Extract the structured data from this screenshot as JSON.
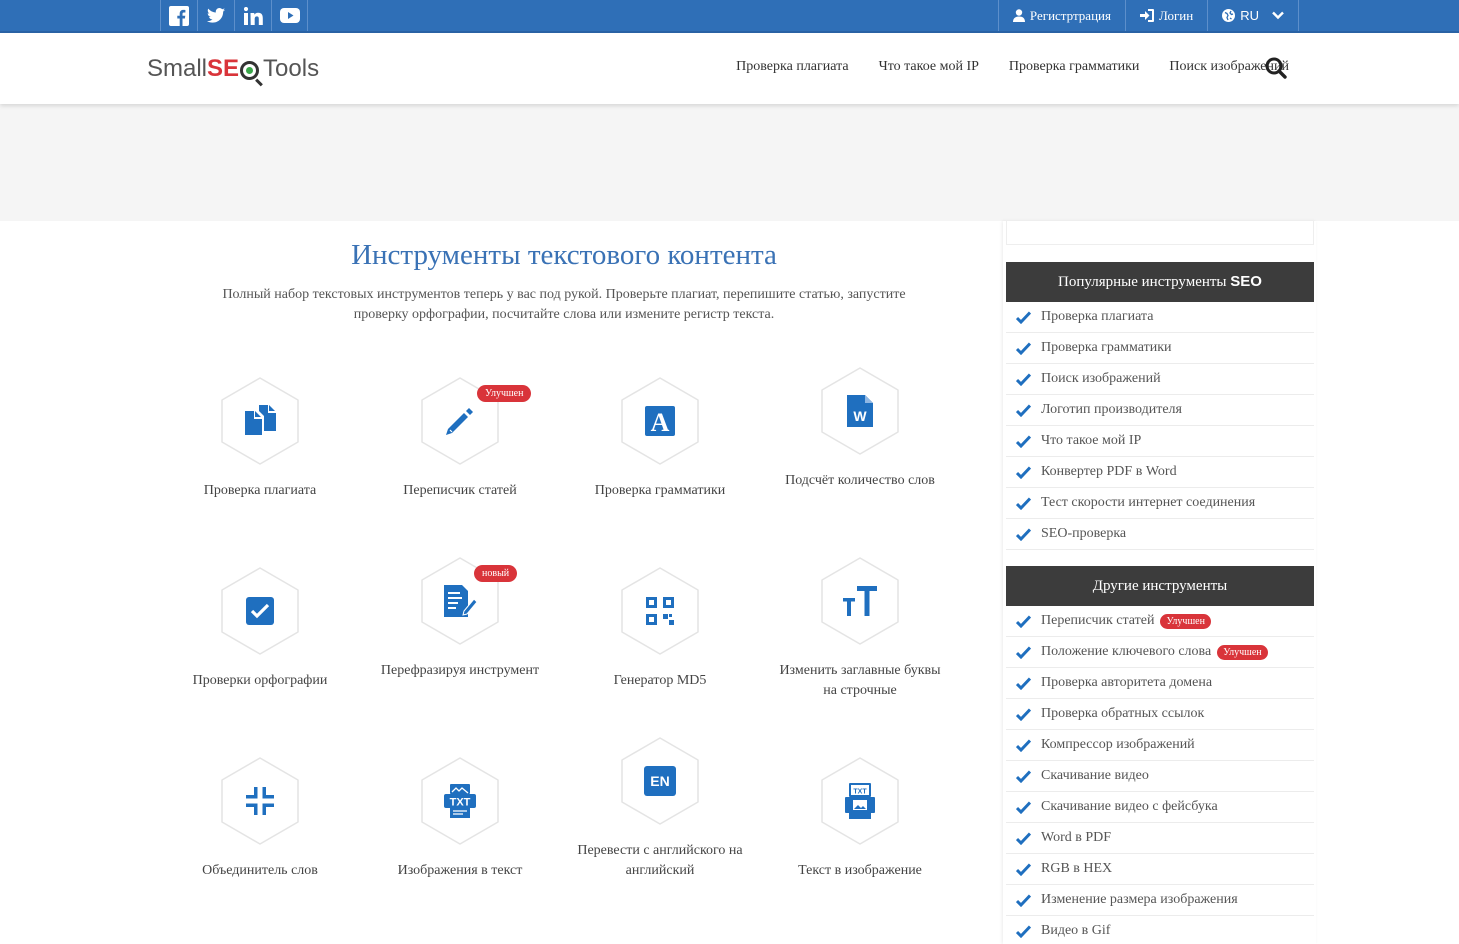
{
  "topbar": {
    "social": [
      "facebook-icon",
      "twitter-icon",
      "linkedin-icon",
      "youtube-icon"
    ],
    "register": "Регистртрация",
    "login": "Логин",
    "language": "RU"
  },
  "header": {
    "logo": {
      "small": "Small",
      "seo_s": "S",
      "seo_e": "E",
      "tools": "Tools"
    },
    "nav": [
      "Проверка плагиата",
      "Что такое мой IP",
      "Проверка грамматики",
      "Поиск изображений"
    ]
  },
  "main": {
    "title": "Инструменты текстового контента",
    "description": "Полный набор текстовых инструментов теперь у вас под рукой. Проверьте плагиат, перепишите статью, запустите проверку орфографии, посчитайте слова или измените регистр текста.",
    "tools": [
      {
        "label": "Проверка плагиата",
        "icon": "copy-files-icon"
      },
      {
        "label": "Переписчик статей",
        "icon": "pencil-icon",
        "badge": "Улучшен"
      },
      {
        "label": "Проверка грамматики",
        "icon": "letter-a-icon"
      },
      {
        "label": "Подсчёт количество слов",
        "icon": "word-doc-icon"
      },
      {
        "label": "Проверки орфографии",
        "icon": "checkbox-icon"
      },
      {
        "label": "Перефразируя инструмент",
        "icon": "doc-edit-icon",
        "badge": "новый"
      },
      {
        "label": "Генератор MD5",
        "icon": "qr-code-icon"
      },
      {
        "label": "Изменить заглавные буквы на строчные",
        "icon": "text-case-icon"
      },
      {
        "label": "Объединитель слов",
        "icon": "compress-icon"
      },
      {
        "label": "Изображения в текст",
        "icon": "image-to-txt-icon"
      },
      {
        "label": "Перевести с английского на английский",
        "icon": "en-icon"
      },
      {
        "label": "Текст в изображение",
        "icon": "txt-to-image-icon"
      }
    ]
  },
  "sidebar": {
    "popular_title_text": "Популярные инструменты",
    "popular_title_bold": "SEO",
    "popular": [
      "Проверка плагиата",
      "Проверка грамматики",
      "Поиск изображений",
      "Логотип производителя",
      "Что такое мой IP",
      "Конвертер PDF в Word",
      "Тест скорости интернет соединения",
      "SEO-проверка"
    ],
    "other_title": "Другие инструменты",
    "other": [
      {
        "label": "Переписчик статей",
        "badge": "Улучшен"
      },
      {
        "label": "Положение ключевого слова",
        "badge": "Улучшен"
      },
      {
        "label": "Проверка авторитета домена"
      },
      {
        "label": "Проверка обратных ссылок"
      },
      {
        "label": "Компрессор изображений"
      },
      {
        "label": "Скачивание видео"
      },
      {
        "label": "Скачивание видео с фейсбука"
      },
      {
        "label": "Word в PDF"
      },
      {
        "label": "RGB в HEX"
      },
      {
        "label": "Изменение размера изображения"
      },
      {
        "label": "Видео в Gif"
      }
    ]
  },
  "colors": {
    "brand_blue": "#2f6fb7",
    "badge_red": "#d9343a",
    "title_blue": "#3a72b5",
    "dark_header": "#3c3c3c"
  }
}
